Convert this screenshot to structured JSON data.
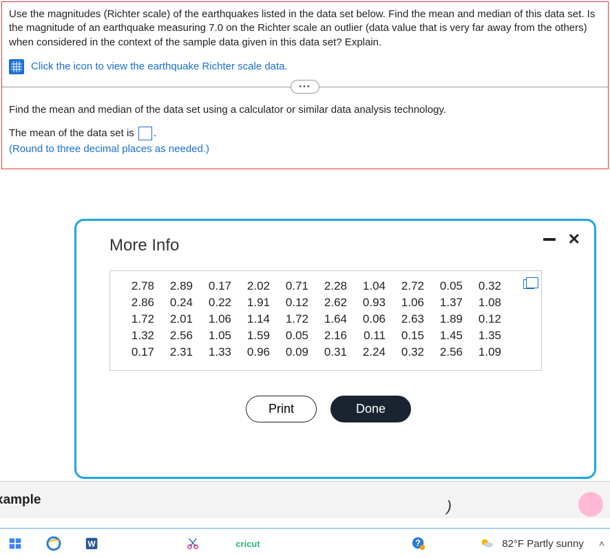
{
  "question": {
    "text": "Use the magnitudes (Richter scale) of the earthquakes listed in the data set below. Find the mean and median of this data set. Is the magnitude of an earthquake measuring 7.0 on the Richter scale an outlier (data value that is very far away from the others) when considered in the context of the sample data given in this data set? Explain.",
    "link_text": "Click the icon to view the earthquake Richter scale data.",
    "instruction": "Find the mean and median of the data set using a calculator or similar data analysis technology.",
    "answer_prefix": "The mean of the data set is",
    "answer_suffix": ".",
    "round_note": "(Round to three decimal places as needed.)"
  },
  "modal": {
    "title": "More Info",
    "buttons": {
      "print": "Print",
      "done": "Done"
    },
    "data": [
      [
        "2.78",
        "2.89",
        "0.17",
        "2.02",
        "0.71",
        "2.28",
        "1.04",
        "2.72",
        "0.05",
        "0.32"
      ],
      [
        "2.86",
        "0.24",
        "0.22",
        "1.91",
        "0.12",
        "2.62",
        "0.93",
        "1.06",
        "1.37",
        "1.08"
      ],
      [
        "1.72",
        "2.01",
        "1.06",
        "1.14",
        "1.72",
        "1.64",
        "0.06",
        "2.63",
        "1.89",
        "0.12"
      ],
      [
        "1.32",
        "2.56",
        "1.05",
        "1.59",
        "0.05",
        "2.16",
        "0.11",
        "0.15",
        "1.45",
        "1.35"
      ],
      [
        "0.17",
        "2.31",
        "1.33",
        "0.96",
        "0.09",
        "0.31",
        "2.24",
        "0.32",
        "2.56",
        "1.09"
      ]
    ]
  },
  "bottom": {
    "partial_label": "xample",
    "weather": "82°F  Partly sunny",
    "cricut": "cricut"
  }
}
